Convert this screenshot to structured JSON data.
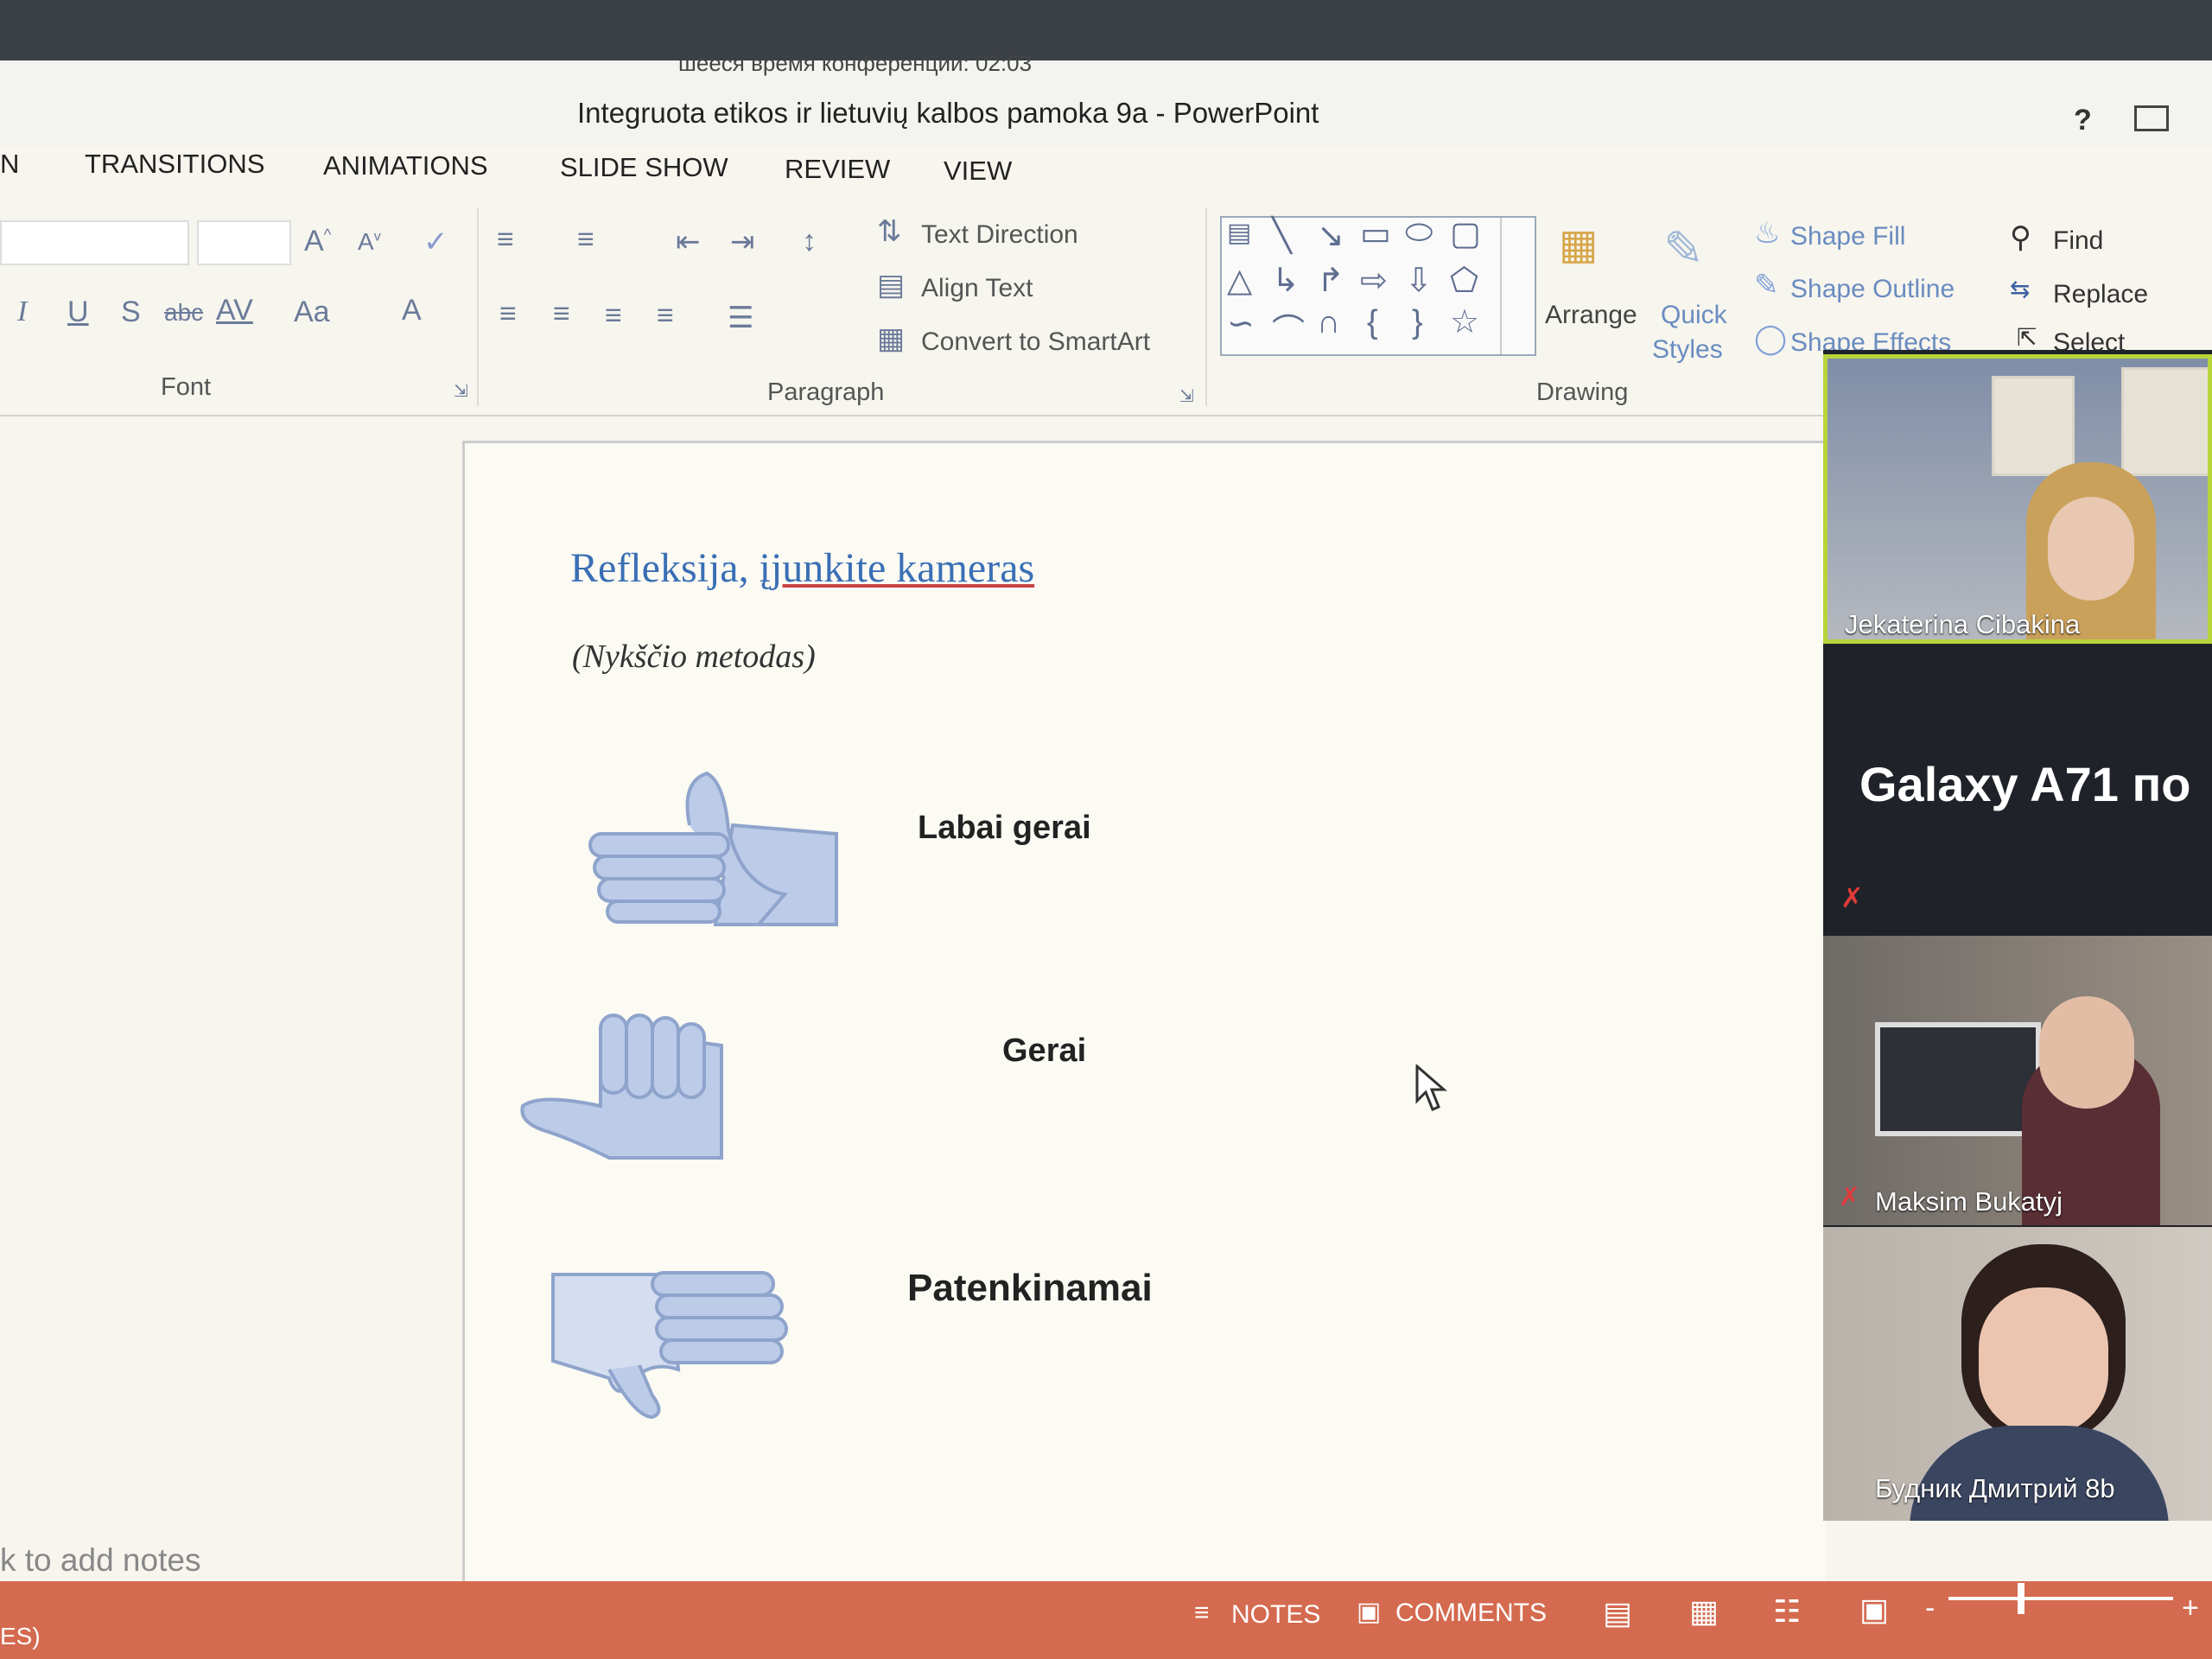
{
  "conference": {
    "timer_text": "шееся время конференции: 02:03"
  },
  "window": {
    "title": "Integruota etikos ir lietuvių kalbos pamoka 9a - PowerPoint",
    "help": "?"
  },
  "tabs": [
    "N",
    "TRANSITIONS",
    "ANIMATIONS",
    "SLIDE SHOW",
    "REVIEW",
    "VIEW"
  ],
  "ribbon": {
    "font_group_label": "Font",
    "paragraph_group_label": "Paragraph",
    "drawing_group_label": "Drawing",
    "text_direction": "Text Direction",
    "align_text": "Align Text",
    "convert_smartart": "Convert to SmartArt",
    "arrange": "Arrange",
    "quick": "Quick",
    "styles": "Styles",
    "shape_fill": "Shape Fill",
    "shape_outline": "Shape Outline",
    "shape_effects": "Shape Effects",
    "find": "Find",
    "replace": "Replace",
    "select": "Select",
    "font_italic": "I",
    "font_underline": "U",
    "font_shadow": "S",
    "font_strike": "abc",
    "font_spacing": "AV",
    "font_case": "Aa",
    "font_color": "A"
  },
  "slide": {
    "title_part1": "Refleksija,",
    "title_part2": "įjunkite kameras",
    "subtitle": "(Nykščio metodas)",
    "items": [
      "Labai gerai",
      "Gerai",
      "Patenkinamai"
    ]
  },
  "notes_hint": "k to add notes",
  "status": {
    "left": "ES)",
    "notes": "NOTES",
    "comments": "COMMENTS"
  },
  "participants": [
    {
      "name": "Jekaterina Cibakina"
    },
    {
      "name": "Galaxy A71 по"
    },
    {
      "name": "Maksim Bukatyj"
    },
    {
      "name": "Будник Дмитрий 8b"
    }
  ],
  "colors": {
    "statusbar": "#d46a4f",
    "slide_title": "#3a6fb5",
    "speaker_border": "#b8d43a"
  }
}
